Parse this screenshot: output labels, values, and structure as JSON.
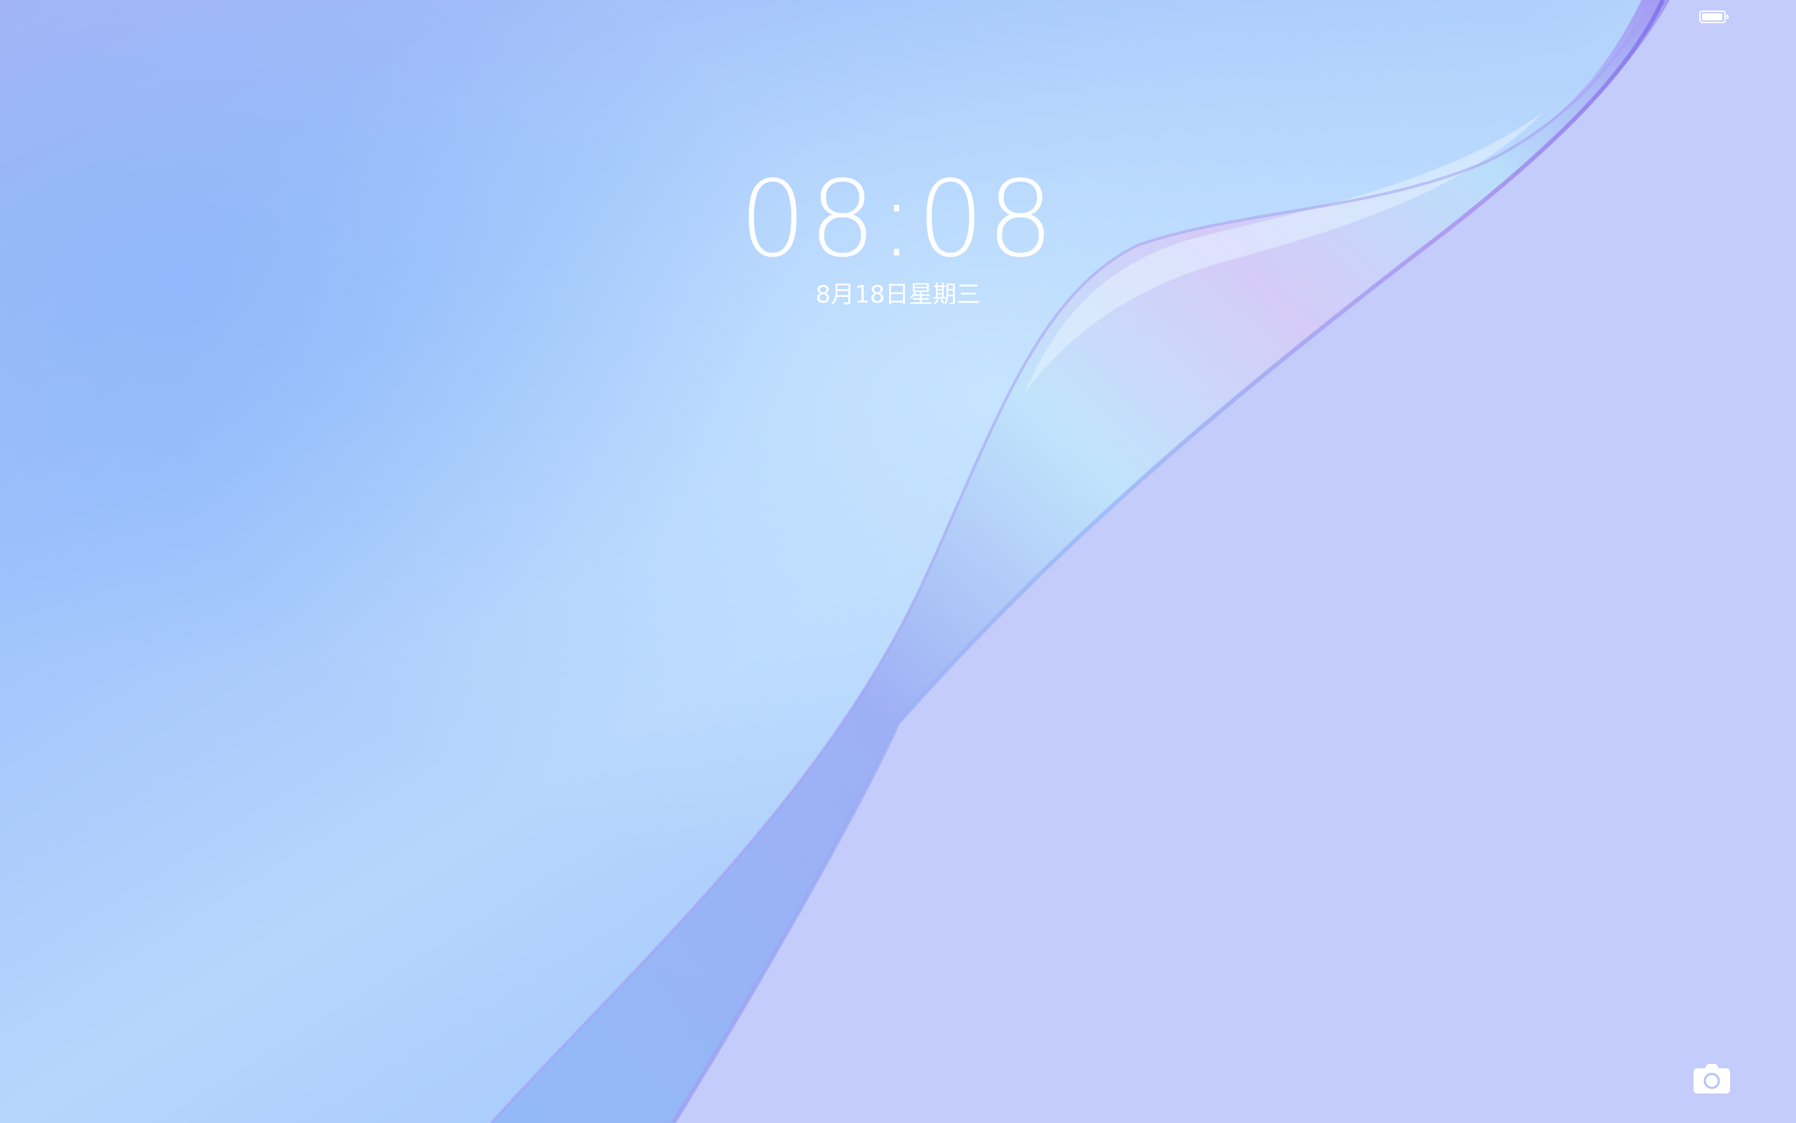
{
  "lockscreen": {
    "time": "08:08",
    "date": "8月18日星期三"
  },
  "status_bar": {
    "battery_level_percent": 95,
    "battery_icon": "battery-icon"
  },
  "shortcuts": {
    "camera_icon": "camera-icon"
  },
  "colors": {
    "text": "#ffffff",
    "background_left": "#9fc3fb",
    "background_right": "#c3ccfb",
    "wave_accent": "#8a7ef0"
  }
}
